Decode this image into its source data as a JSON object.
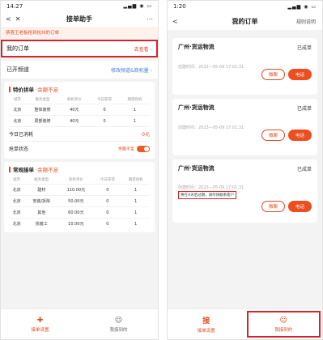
{
  "left": {
    "status": {
      "time": "14:27",
      "icons": "▂▄▆ ◉ ▭"
    },
    "nav": {
      "title": "接单助手"
    },
    "notice": "恭喜王老板抢到杭州的订单",
    "my_orders": {
      "label": "我的订单",
      "link": "去查看"
    },
    "channels": {
      "label": "已开频道",
      "link": "修改频道&商机量"
    },
    "special": {
      "title": "特价拼单",
      "warn": "·余额不足",
      "headers": [
        "城市",
        "服务类型",
        "商机单价",
        "今日获得",
        "期望商机"
      ],
      "rows": [
        [
          "北京",
          "整体装修",
          "40元",
          "0",
          "1"
        ],
        [
          "北京",
          "局部装修",
          "40元",
          "0",
          "1"
        ]
      ],
      "consumed_label": "今日已消耗",
      "consumed_value": "0元",
      "grab_label": "抢单状态",
      "grab_value": "余额不足"
    },
    "regular": {
      "title": "常规接单",
      "warn": "·余额不足",
      "headers": [
        "城市",
        "服务类型",
        "商机单价",
        "今日获得",
        "期望商机"
      ],
      "rows": [
        [
          "北京",
          "建材",
          "110.00元",
          "0",
          "1"
        ],
        [
          "北京",
          "安装/拆除",
          "50.00元",
          "0",
          "1"
        ],
        [
          "北京",
          "其他",
          "60.00元",
          "0",
          "1"
        ],
        [
          "北京",
          "找装工",
          "10.00元",
          "0",
          "1"
        ]
      ]
    },
    "tabbar": [
      {
        "icon": "✚",
        "label": "接单设置"
      },
      {
        "icon": "☺",
        "label": "我接到的"
      }
    ]
  },
  "right": {
    "status": {
      "time": "1:20",
      "icons": "▂▄▆ ◉ ▭"
    },
    "nav": {
      "title": "我的订单",
      "action": "规则说明"
    },
    "orders": [
      {
        "title": "广州·货运物流",
        "status": "已成单",
        "time": "创建时间：2023—05-09 17:01:31",
        "btn_outline": "微聊",
        "btn_fill": "电话"
      },
      {
        "title": "广州·货运物流",
        "status": "已成单",
        "time": "创建时间：2023—05-09 17:01:31",
        "btn_outline": "微聊",
        "btn_fill": "电话"
      },
      {
        "title": "广州·货运物流",
        "status": "已成单",
        "time": "创建时间：2023—05-09 17:01:31",
        "btn_outline": "微聊",
        "btn_fill": "电话",
        "expire": "将在X天后过期，请尽快联系客户"
      }
    ],
    "tabbar": [
      {
        "icon": "接",
        "label": "接单设置"
      },
      {
        "icon": "☺",
        "label": "我接到的"
      }
    ]
  }
}
